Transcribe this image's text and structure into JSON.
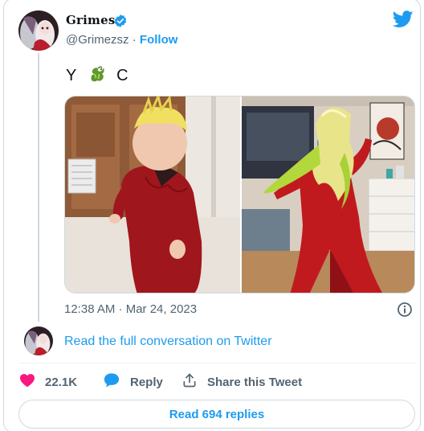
{
  "author": {
    "name": "Grimes",
    "handle": "@Grimezsz",
    "separator": " · ",
    "follow_label": "Follow"
  },
  "tweet": {
    "text_left": "Y",
    "emoji_name": "dragon-emoji",
    "text_right": "C",
    "timestamp": "12:38 AM · Mar 24, 2023"
  },
  "conversation_link": "Read the full conversation on Twitter",
  "actions": {
    "like_count": "22.1K",
    "reply_label": "Reply",
    "share_label": "Share this Tweet"
  },
  "replies_button": "Read 694 replies",
  "icons": [
    "verified-badge-icon",
    "twitter-bird-icon",
    "info-icon",
    "heart-icon",
    "reply-bubble-icon",
    "share-icon"
  ],
  "colors": {
    "accent": "#1d9bf0",
    "like": "#f91880",
    "muted": "#536471",
    "border": "#cfd9de"
  }
}
